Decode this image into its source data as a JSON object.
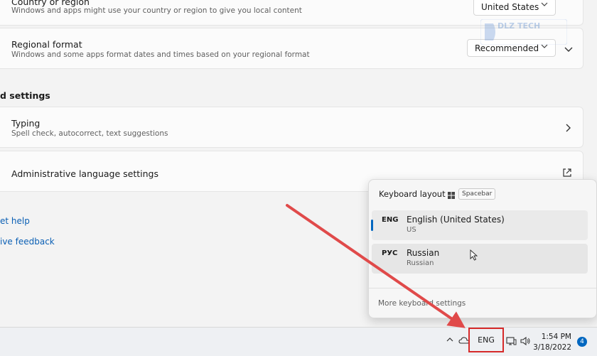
{
  "settings": {
    "country": {
      "title": "Country or region",
      "desc": "Windows and apps might use your country or region to give you local content",
      "value": "United States"
    },
    "regional": {
      "title": "Regional format",
      "desc": "Windows and some apps format dates and times based on your regional format",
      "value": "Recommended"
    },
    "related_heading": "d settings",
    "typing": {
      "title": "Typing",
      "desc": "Spell check, autocorrect, text suggestions"
    },
    "admin": {
      "title": "Administrative language settings"
    },
    "links": {
      "help": "et help",
      "feedback": "ive feedback"
    }
  },
  "watermark": {
    "text": "DLZ TECH"
  },
  "flyout": {
    "title": "Keyboard layout",
    "shortcut": "Spacebar",
    "items": [
      {
        "code": "ENG",
        "name": "English (United States)",
        "sub": "US",
        "selected": true
      },
      {
        "code": "РУС",
        "name": "Russian",
        "sub": "Russian",
        "selected": false
      }
    ],
    "more": "More keyboard settings"
  },
  "taskbar": {
    "chevron": "^",
    "lang": "ENG",
    "time": "1:54 PM",
    "date": "3/18/2022",
    "notifications": "4"
  },
  "colors": {
    "accent": "#0067c0",
    "highlight_box": "#d62a2a",
    "arrow": "#e04a4a",
    "link": "#0a5fb4"
  }
}
